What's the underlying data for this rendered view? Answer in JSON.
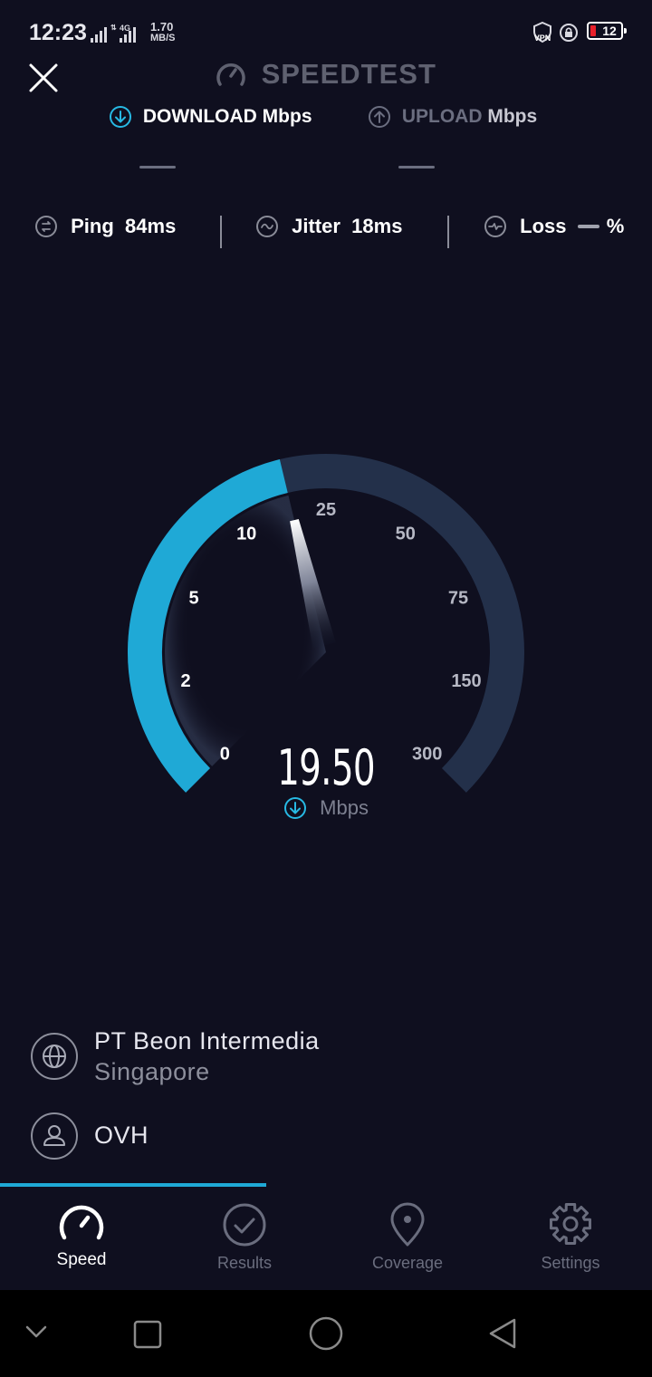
{
  "status_bar": {
    "time": "12:23",
    "network_speed_value": "1.70",
    "network_speed_unit": "MB/S",
    "network_type": "4G",
    "vpn_label": "VPN",
    "battery_level": "12",
    "battery_color": "#e8202a"
  },
  "header": {
    "title": "SPEEDTEST",
    "download_label": "DOWNLOAD",
    "download_unit": "Mbps",
    "upload_label": "UPLOAD",
    "upload_unit": "Mbps"
  },
  "stats": {
    "ping_label": "Ping",
    "ping_value": "84ms",
    "jitter_label": "Jitter",
    "jitter_value": "18ms",
    "loss_label": "Loss",
    "loss_value": "%"
  },
  "gauge": {
    "tick_labels": [
      "0",
      "2",
      "5",
      "10",
      "25",
      "50",
      "75",
      "150",
      "300"
    ],
    "readout_value": "19.50",
    "readout_unit": "Mbps",
    "progress_fraction": 0.45,
    "accent_color": "#1fa9d6",
    "track_color": "#23304a"
  },
  "server": {
    "provider": "PT Beon Intermedia",
    "location": "Singapore",
    "host": "OVH"
  },
  "bottom_nav": {
    "items": [
      {
        "label": "Speed",
        "icon": "speedometer-icon",
        "active": true
      },
      {
        "label": "Results",
        "icon": "check-circle-icon",
        "active": false
      },
      {
        "label": "Coverage",
        "icon": "map-pin-icon",
        "active": false
      },
      {
        "label": "Settings",
        "icon": "gear-icon",
        "active": false
      }
    ]
  },
  "system_nav": {
    "icons": [
      "chevron-down-icon",
      "recents-square-icon",
      "home-circle-icon",
      "back-triangle-icon"
    ]
  }
}
